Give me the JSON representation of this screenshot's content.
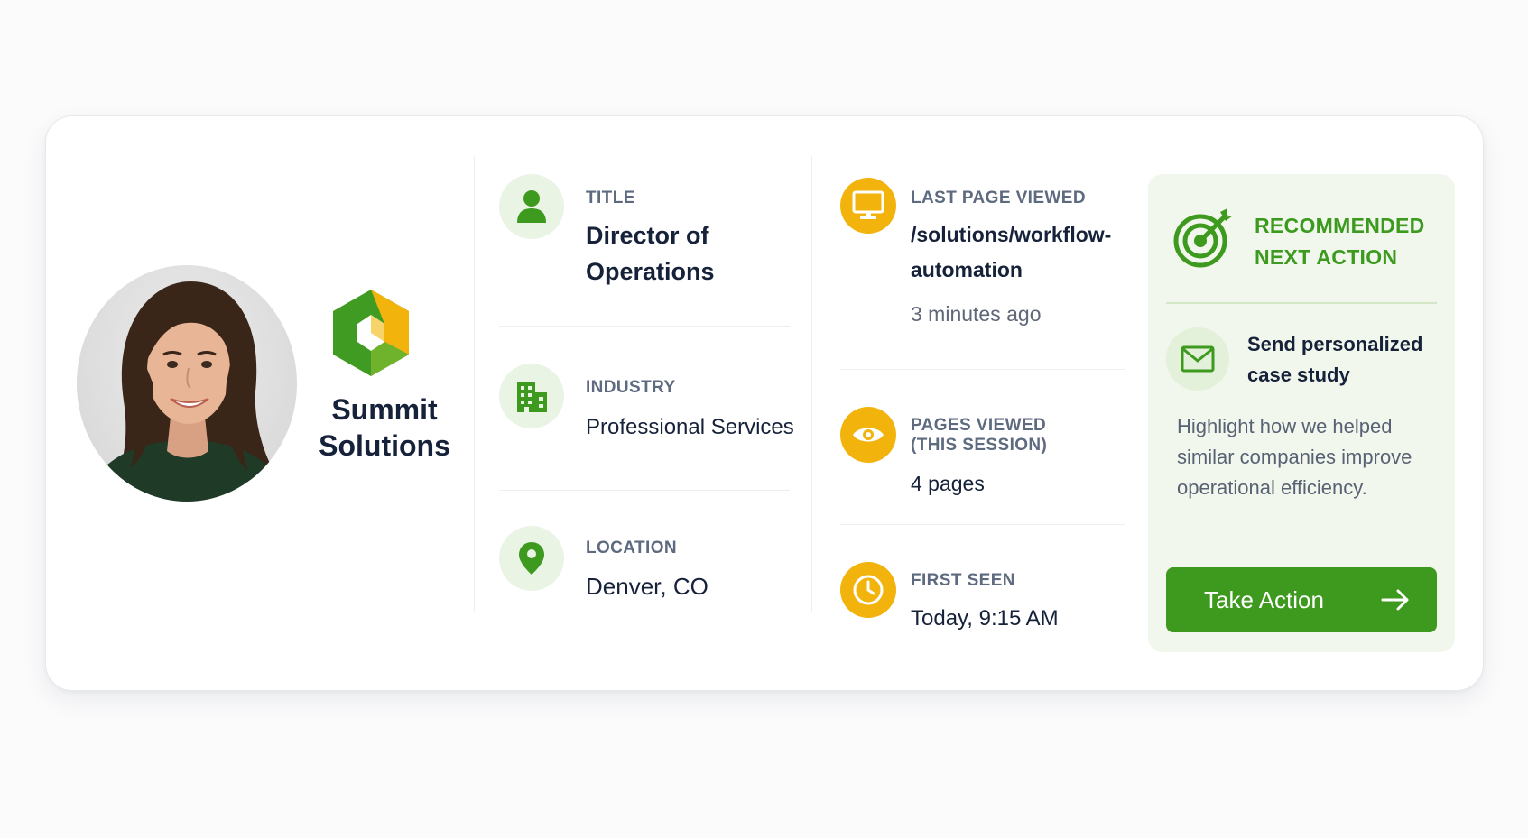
{
  "profile": {
    "company_name": "Summit Solutions"
  },
  "details": {
    "title": {
      "label": "TITLE",
      "value": "Director of Operations"
    },
    "industry": {
      "label": "INDUSTRY",
      "value": "Professional Services"
    },
    "location": {
      "label": "LOCATION",
      "value": "Denver, CO"
    }
  },
  "activity": {
    "last_page": {
      "label": "LAST PAGE VIEWED",
      "value_line1": "/solutions/workflow-",
      "value_line2": "automation",
      "time": "3 minutes ago"
    },
    "pages_viewed": {
      "label_line1": "PAGES VIEWED",
      "label_line2": "(THIS SESSION)",
      "value": "4 pages"
    },
    "first_seen": {
      "label": "FIRST SEEN",
      "value": "Today, 9:15 AM"
    }
  },
  "recommendation": {
    "title_line1": "RECOMMENDED",
    "title_line2": "NEXT ACTION",
    "action": "Send personalized case study",
    "description": "Highlight how we helped similar companies improve operational efficiency.",
    "button_label": "Take Action"
  },
  "icons": {
    "title": "person-icon",
    "industry": "building-icon",
    "location": "map-pin-icon",
    "last_page": "monitor-icon",
    "pages_viewed": "eye-icon",
    "first_seen": "clock-icon",
    "recommendation": "target-icon",
    "action": "mail-icon",
    "button": "arrow-right-icon"
  },
  "colors": {
    "brand_green": "#3d9a1e",
    "amber": "#f2b40c",
    "panel_bg": "#f1f7ec",
    "text_dark": "#16213a",
    "label_gray": "#5d6a7f"
  }
}
